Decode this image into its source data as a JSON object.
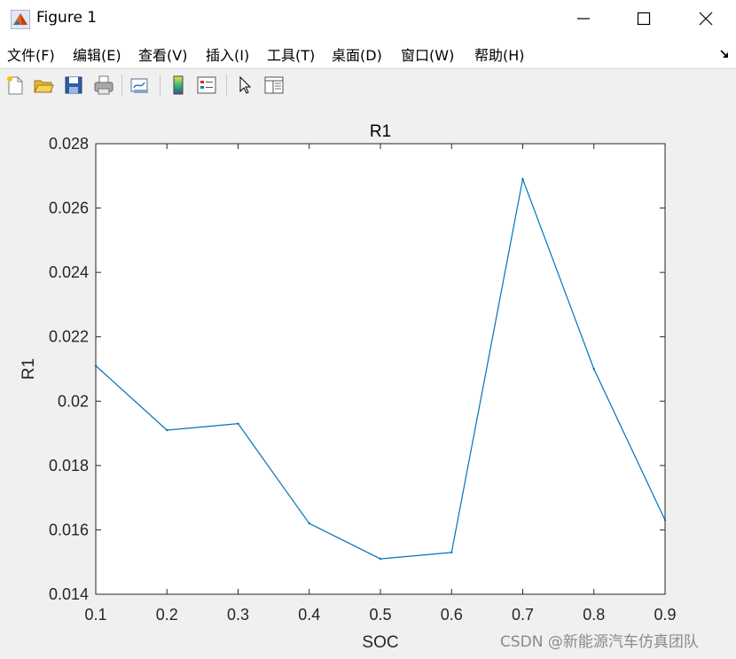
{
  "window": {
    "title": "Figure 1",
    "controls": {
      "minimize": "—",
      "maximize": "☐",
      "close": "✕"
    }
  },
  "menu": {
    "items": [
      {
        "label": "文件(F)"
      },
      {
        "label": "编辑(E)"
      },
      {
        "label": "查看(V)"
      },
      {
        "label": "插入(I)"
      },
      {
        "label": "工具(T)"
      },
      {
        "label": "桌面(D)"
      },
      {
        "label": "窗口(W)"
      },
      {
        "label": "帮助(H)"
      }
    ]
  },
  "toolbar": {
    "buttons": [
      {
        "icon": "new-figure-icon"
      },
      {
        "icon": "open-file-icon"
      },
      {
        "icon": "save-icon"
      },
      {
        "icon": "print-icon"
      },
      {
        "icon": "link-plot-icon"
      },
      {
        "icon": "colorbar-icon"
      },
      {
        "icon": "legend-icon"
      },
      {
        "icon": "pointer-icon"
      },
      {
        "icon": "property-editor-icon"
      }
    ]
  },
  "chart_data": {
    "type": "line",
    "title": "R1",
    "xlabel": "SOC",
    "ylabel": "R1",
    "xlim": [
      0.1,
      0.9
    ],
    "ylim": [
      0.014,
      0.028
    ],
    "xticks": [
      "0.1",
      "0.2",
      "0.3",
      "0.4",
      "0.5",
      "0.6",
      "0.7",
      "0.8",
      "0.9"
    ],
    "yticks": [
      "0.014",
      "0.016",
      "0.018",
      "0.02",
      "0.022",
      "0.024",
      "0.026",
      "0.028"
    ],
    "grid": false,
    "series": [
      {
        "color": "#0072bd",
        "x": [
          0.1,
          0.2,
          0.3,
          0.4,
          0.5,
          0.6,
          0.7,
          0.8,
          0.9
        ],
        "values": [
          0.0211,
          0.0191,
          0.0193,
          0.0162,
          0.0151,
          0.0153,
          0.0269,
          0.021,
          0.0163
        ]
      }
    ]
  },
  "watermark": "CSDN @新能源汽车仿真团队"
}
